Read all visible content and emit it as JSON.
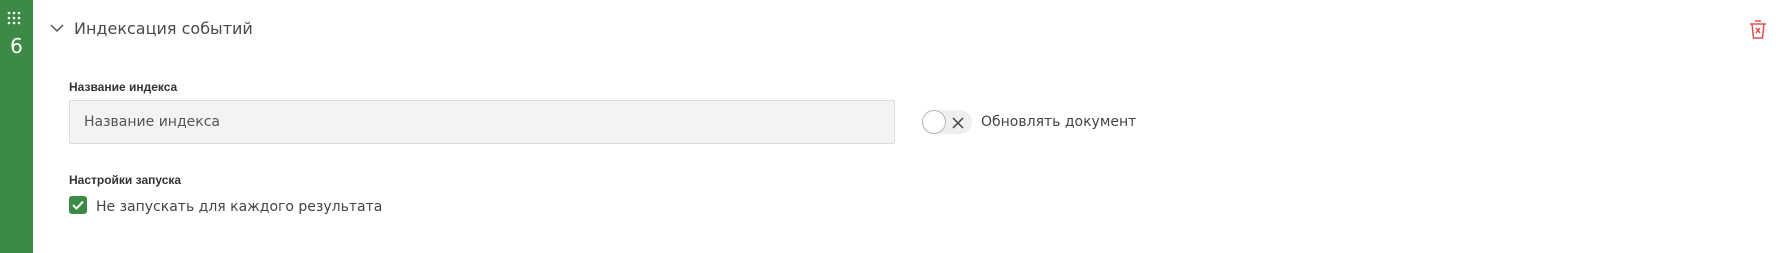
{
  "step": {
    "number": "6",
    "title": "Индексация событий",
    "rail_color": "#3c8a45"
  },
  "icons": {
    "drag": "drag-dots-icon",
    "collapse": "chevron-down-icon",
    "delete": "trash-icon",
    "toggle_off": "close-icon",
    "check": "checkmark-icon"
  },
  "index_field": {
    "label": "Название индекса",
    "placeholder": "Название индекса",
    "value": ""
  },
  "update_toggle": {
    "label": "Обновлять документ",
    "state": "off"
  },
  "run_settings": {
    "label": "Настройки запуска",
    "checkbox_label": "Не запускать для каждого результата",
    "checked": true
  },
  "colors": {
    "accent": "#3c8a45",
    "delete": "#d9534f"
  }
}
